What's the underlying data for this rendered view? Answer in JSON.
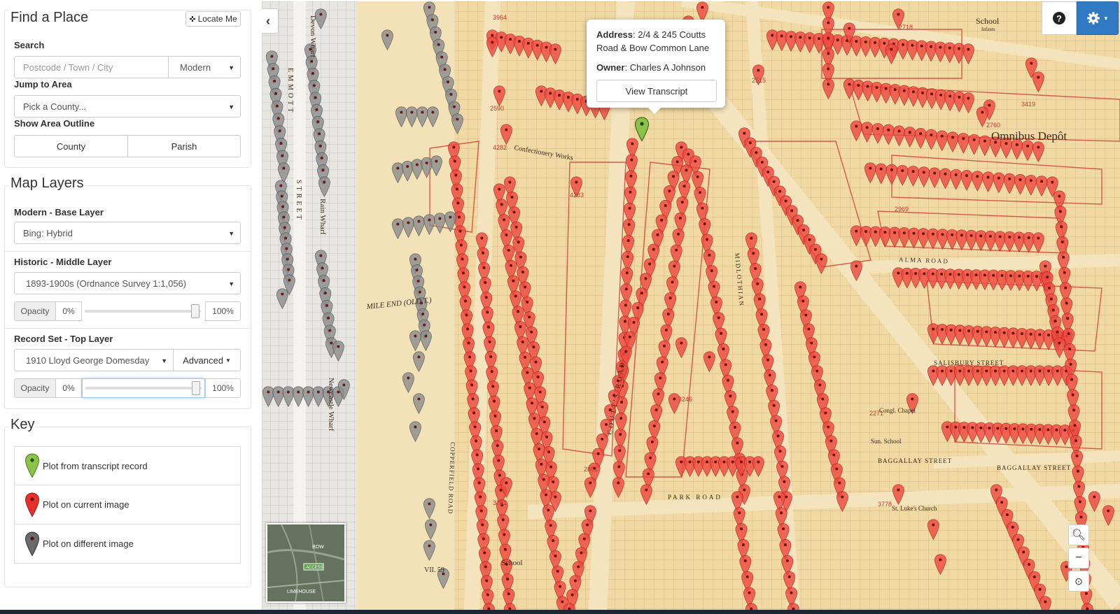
{
  "sidebar": {
    "find_place": {
      "title": "Find a Place",
      "locate_me": "Locate Me",
      "search_label": "Search",
      "search_placeholder": "Postcode / Town / City",
      "search_mode": "Modern",
      "jump_label": "Jump to Area",
      "jump_value": "Pick a County...",
      "outline_label": "Show Area Outline",
      "outline_county": "County",
      "outline_parish": "Parish"
    },
    "map_layers": {
      "title": "Map Layers",
      "base_label": "Modern - Base Layer",
      "base_value": "Bing: Hybrid",
      "middle_label": "Historic - Middle Layer",
      "middle_value": "1893-1900s (Ordnance Survey 1:1,056)",
      "middle_opacity": {
        "label": "Opacity",
        "min": "0%",
        "max": "100%",
        "value": 0.95
      },
      "top_label": "Record Set - Top Layer",
      "top_value": "1910 Lloyd George Domesday",
      "top_advanced": "Advanced",
      "top_opacity": {
        "label": "Opacity",
        "min": "0%",
        "max": "100%",
        "value": 0.95
      }
    },
    "key": {
      "title": "Key",
      "items": [
        {
          "label": "Plot from transcript record",
          "color": "#8bc34a"
        },
        {
          "label": "Plot on current image",
          "color": "#e8302a"
        },
        {
          "label": "Plot on different image",
          "color": "#6b6b6b"
        }
      ]
    }
  },
  "map": {
    "popup": {
      "address_label": "Address",
      "address_value": "2/4 & 245 Coutts Road & Bow Common Lane",
      "owner_label": "Owner",
      "owner_value": "Charles A Johnson",
      "view_transcript": "View Transcript"
    },
    "labels": {
      "omnibus": "Omnibus Depôt",
      "confectionery": "Confectionery Works",
      "school_infants": "School",
      "infants": "Infants",
      "mile_end": "MILE END (OLD T.)",
      "copperfield": "COPPERFIELD ROAD",
      "alma": "ALMA ROAD",
      "salisbury": "SALISBURY STREET",
      "baggallay": "BAGGALLAY STREET",
      "baggallay2": "BAGGALLAY STREET",
      "sun_school": "Sun. School",
      "congl_chapel": "Congl. Chapel",
      "st_lukes": "St. Luke's Church",
      "school2": "School",
      "vii": "VII. 59",
      "devon_wharf": "Devon Wharf",
      "emmott": "EMMOTT",
      "street": "STREET",
      "rain_wharf": "Rain Wharf",
      "newcastle_wharf": "Newcastle Wharf",
      "coutts_road": "COUTT'S ROAD",
      "midlothian": "MIDLOTHIAN",
      "park_road": "PARK ROAD",
      "plot_numbers": [
        "3964",
        "2718",
        "2590",
        "4282",
        "4283",
        "3419",
        "2760",
        "2969",
        "3246",
        "2271",
        "3778",
        "2851",
        "2515",
        "3781"
      ]
    },
    "minimap": {
      "bow": "BOW",
      "limehouse": "LIMEHOUSE",
      "access": "ACCESS"
    },
    "controls": {
      "collapse": "‹",
      "help": "?",
      "zoom_in": "+",
      "zoom_out": "−",
      "reset": "⊙"
    }
  }
}
